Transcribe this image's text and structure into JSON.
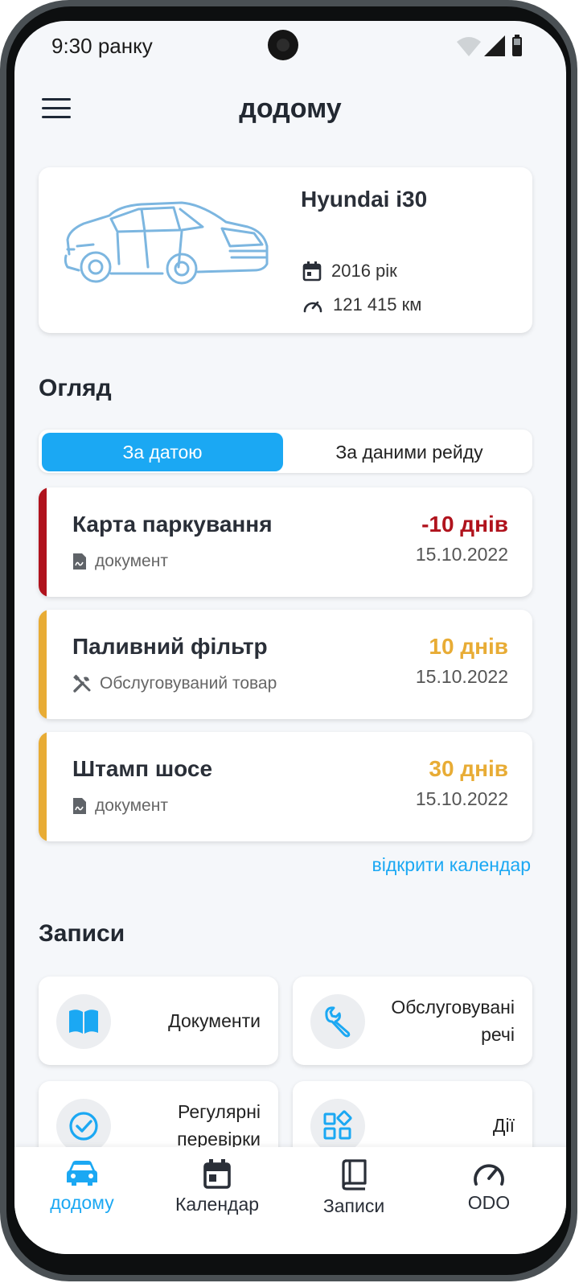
{
  "status_bar": {
    "time": "9:30 ранку"
  },
  "header": {
    "title": "додому",
    "menu_icon": "hamburger-menu-icon"
  },
  "vehicle": {
    "name": "Hyundai i30",
    "year": "2016 рік",
    "mileage": "121 415 км"
  },
  "overview": {
    "title": "Огляд",
    "tabs": [
      {
        "label": "За датою",
        "selected": true
      },
      {
        "label": "За даними рейду",
        "selected": false
      }
    ],
    "items": [
      {
        "title": "Карта паркування",
        "subtitle": "документ",
        "icon": "document-icon",
        "days": "-10 днів",
        "date": "15.10.2022",
        "status_color": "#b0131d"
      },
      {
        "title": "Паливний фільтр",
        "subtitle": "Обслуговуваний товар",
        "icon": "tools-icon",
        "days": "10 днів",
        "date": "15.10.2022",
        "status_color": "#e8ac35"
      },
      {
        "title": "Штамп шосе",
        "subtitle": "документ",
        "icon": "document-icon",
        "days": "30 днів",
        "date": "15.10.2022",
        "status_color": "#e8ac35"
      }
    ],
    "calendar_link": "відкрити календар"
  },
  "records": {
    "title": "Записи",
    "tiles": [
      {
        "label": "Документи",
        "icon": "book-icon"
      },
      {
        "label": "Обслуговувані речі",
        "icon": "wrench-icon"
      },
      {
        "label": "Регулярні перевірки",
        "icon": "check-circle-icon"
      },
      {
        "label": "Дії",
        "icon": "apps-icon"
      }
    ]
  },
  "bottom_nav": [
    {
      "label": "додому",
      "icon": "car-icon",
      "active": true
    },
    {
      "label": "Календар",
      "icon": "calendar-icon",
      "active": false
    },
    {
      "label": "Записи",
      "icon": "book-icon",
      "active": false
    },
    {
      "label": "ODO",
      "icon": "speedometer-icon",
      "active": false
    }
  ],
  "colors": {
    "accent": "#1ba8f3",
    "overdue": "#b0131d",
    "warning": "#e8ac35"
  }
}
